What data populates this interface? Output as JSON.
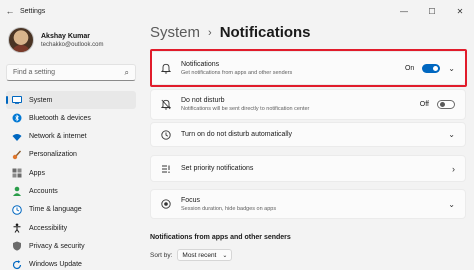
{
  "window": {
    "title": "Settings"
  },
  "profile": {
    "name": "Akshay Kumar",
    "email": "techakko@outlook.com"
  },
  "search": {
    "placeholder": "Find a setting"
  },
  "sidebar": {
    "items": [
      {
        "label": "System",
        "icon": "system-icon",
        "color": "#0067c0"
      },
      {
        "label": "Bluetooth & devices",
        "icon": "bluetooth-icon",
        "color": "#0078d4"
      },
      {
        "label": "Network & internet",
        "icon": "wifi-icon",
        "color": "#0067c0"
      },
      {
        "label": "Personalization",
        "icon": "brush-icon",
        "color": "#e0782e"
      },
      {
        "label": "Apps",
        "icon": "apps-icon",
        "color": "#5a5a5a"
      },
      {
        "label": "Accounts",
        "icon": "person-icon",
        "color": "#2a9d4a"
      },
      {
        "label": "Time & language",
        "icon": "globe-clock-icon",
        "color": "#0067c0"
      },
      {
        "label": "Accessibility",
        "icon": "accessibility-icon",
        "color": "#1a1a1a"
      },
      {
        "label": "Privacy & security",
        "icon": "shield-icon",
        "color": "#6b6b6b"
      },
      {
        "label": "Windows Update",
        "icon": "update-icon",
        "color": "#0067c0"
      }
    ]
  },
  "breadcrumb": {
    "parent": "System",
    "current": "Notifications"
  },
  "cards": [
    {
      "title": "Notifications",
      "subtitle": "Get notifications from apps and other senders",
      "state": "On",
      "icon": "bell-icon",
      "toggle": "on",
      "expand": true
    },
    {
      "title": "Do not disturb",
      "subtitle": "Notifications will be sent directly to notification center",
      "state": "Off",
      "icon": "bell-off-icon",
      "toggle": "off"
    },
    {
      "title": "Turn on do not disturb automatically",
      "subtitle": "",
      "icon": "clock-icon",
      "expand": true
    },
    {
      "title": "Set priority notifications",
      "subtitle": "",
      "icon": "priority-icon",
      "chevron_right": true
    },
    {
      "title": "Focus",
      "subtitle": "Session duration, hide badges on apps",
      "icon": "focus-icon",
      "expand": true
    }
  ],
  "section": {
    "title": "Notifications from apps and other senders"
  },
  "sort": {
    "label": "Sort by:",
    "value": "Most recent"
  },
  "colors": {
    "accent": "#0067c0",
    "highlight": "#e11c2b"
  }
}
